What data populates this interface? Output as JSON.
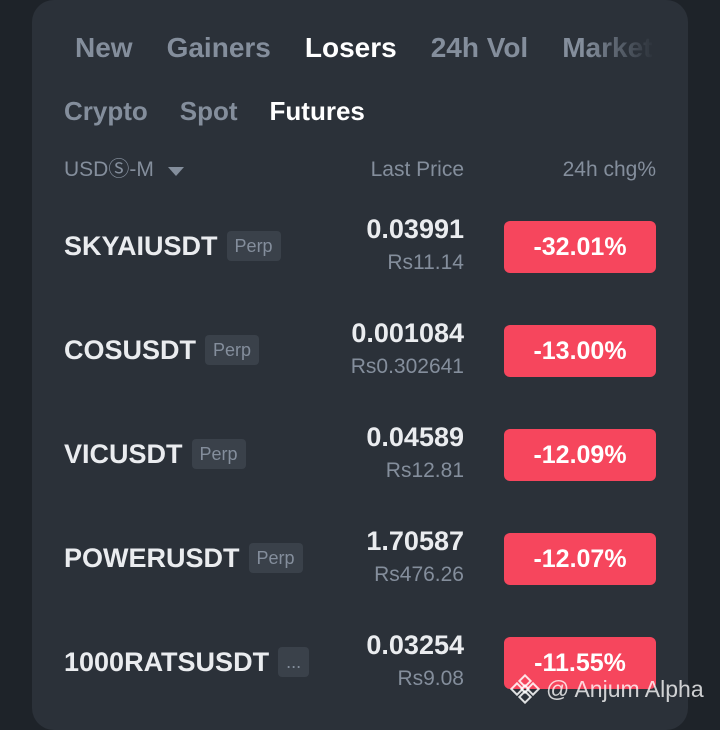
{
  "tabs_primary": [
    "New",
    "Gainers",
    "Losers",
    "24h Vol",
    "Market Cap"
  ],
  "tabs_primary_active": "Losers",
  "tabs_secondary": [
    "Crypto",
    "Spot",
    "Futures"
  ],
  "tabs_secondary_active": "Futures",
  "header": {
    "filter_label": "USDⓈ-M",
    "last_price_label": "Last Price",
    "change_label": "24h chg%"
  },
  "rows": [
    {
      "symbol": "SKYAIUSDT",
      "tag": "Perp",
      "last": "0.03991",
      "fiat": "Rs11.14",
      "change": "-32.01%"
    },
    {
      "symbol": "COSUSDT",
      "tag": "Perp",
      "last": "0.001084",
      "fiat": "Rs0.302641",
      "change": "-13.00%"
    },
    {
      "symbol": "VICUSDT",
      "tag": "Perp",
      "last": "0.04589",
      "fiat": "Rs12.81",
      "change": "-12.09%"
    },
    {
      "symbol": "POWERUSDT",
      "tag": "Perp",
      "last": "1.70587",
      "fiat": "Rs476.26",
      "change": "-12.07%"
    },
    {
      "symbol": "1000RATSUSDT",
      "tag": "...",
      "last": "0.03254",
      "fiat": "Rs9.08",
      "change": "-11.55%"
    }
  ],
  "colors": {
    "background": "#1e2329",
    "panel": "#2b3139",
    "negative": "#f6465d",
    "muted": "#848e9c",
    "text": "#eaecef"
  },
  "watermark": {
    "icon": "binance-logo-icon",
    "text": "@ Anjum Alpha"
  }
}
